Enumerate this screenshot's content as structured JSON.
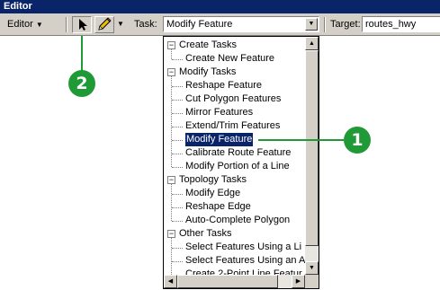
{
  "window": {
    "title": "Editor"
  },
  "toolbar": {
    "editor_menu_label": "Editor",
    "task_label": "Task:",
    "task_value": "Modify Feature",
    "target_label": "Target:",
    "target_value": "routes_hwy"
  },
  "task_list": [
    {
      "label": "Create Tasks",
      "type": "group",
      "expander": "−"
    },
    {
      "label": "Create New Feature",
      "type": "item"
    },
    {
      "label": "Modify Tasks",
      "type": "group",
      "expander": "−"
    },
    {
      "label": "Reshape Feature",
      "type": "item"
    },
    {
      "label": "Cut Polygon Features",
      "type": "item"
    },
    {
      "label": "Mirror Features",
      "type": "item"
    },
    {
      "label": "Extend/Trim Features",
      "type": "item"
    },
    {
      "label": "Modify Feature",
      "type": "item",
      "selected": true
    },
    {
      "label": "Calibrate Route Feature",
      "type": "item"
    },
    {
      "label": "Modify Portion of a Line",
      "type": "item"
    },
    {
      "label": "Topology Tasks",
      "type": "group",
      "expander": "−"
    },
    {
      "label": "Modify Edge",
      "type": "item"
    },
    {
      "label": "Reshape Edge",
      "type": "item"
    },
    {
      "label": "Auto-Complete Polygon",
      "type": "item"
    },
    {
      "label": "Other Tasks",
      "type": "group",
      "expander": "−"
    },
    {
      "label": "Select Features Using a Li",
      "type": "item"
    },
    {
      "label": "Select Features Using an A",
      "type": "item"
    },
    {
      "label": "Create 2-Point Line Featur",
      "type": "item"
    }
  ],
  "callouts": {
    "one": "1",
    "two": "2"
  },
  "colors": {
    "callout": "#1f9a37",
    "selection": "#0a246a",
    "titlebar": "#0a246a"
  },
  "icons": {
    "select_tool": "arrow-pointer-icon",
    "sketch_tool": "pencil-icon"
  }
}
